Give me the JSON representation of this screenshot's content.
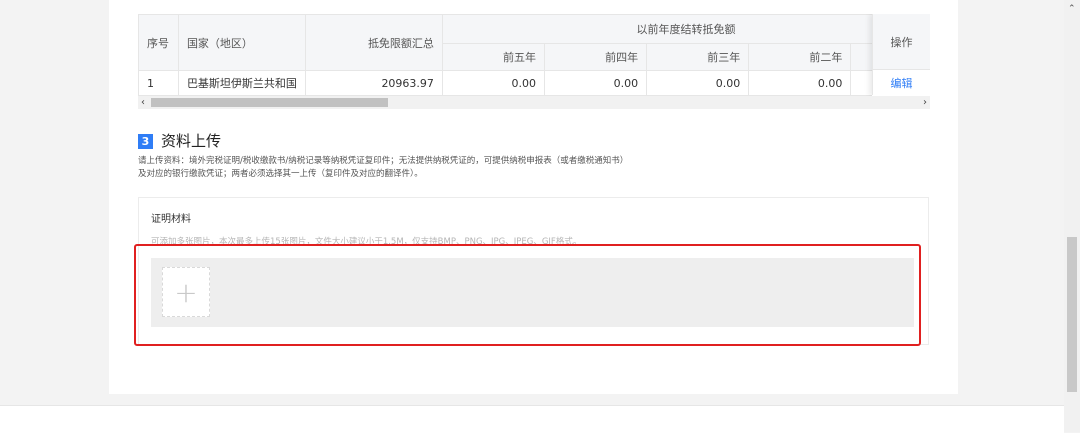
{
  "table": {
    "headers": {
      "seq": "序号",
      "country": "国家（地区）",
      "total": "抵免限额汇总",
      "carry_group": "以前年度结转抵免额",
      "years": [
        "前五年",
        "前四年",
        "前三年",
        "前二年"
      ],
      "ops": "操作"
    },
    "rows": [
      {
        "seq": "1",
        "country": "巴基斯坦伊斯兰共和国",
        "total": "20963.97",
        "years": [
          "0.00",
          "0.00",
          "0.00",
          "0.00"
        ],
        "action": "编辑"
      }
    ],
    "scroll_left": "‹",
    "scroll_right": "›"
  },
  "section": {
    "number": "3",
    "title": "资料上传",
    "desc_line1": "请上传资料：境外完税证明/税收缴款书/纳税记录等纳税凭证复印件；无法提供纳税凭证的，可提供纳税申报表（或者缴税通知书）",
    "desc_line2": "及对应的银行缴款凭证；两者必须选择其一上传（复印件及对应的翻译件）。"
  },
  "upload": {
    "label": "证明材料",
    "hint": "可添加多张图片，本次最多上传15张图片，文件大小建议小于1.5M，仅支持BMP、PNG、JPG、JPEG、GIF格式。",
    "add_symbol": "+"
  },
  "scrollbar": {
    "up_arrow": "⌃"
  },
  "colors": {
    "accent": "#2f7df6",
    "highlight": "#e02020"
  }
}
